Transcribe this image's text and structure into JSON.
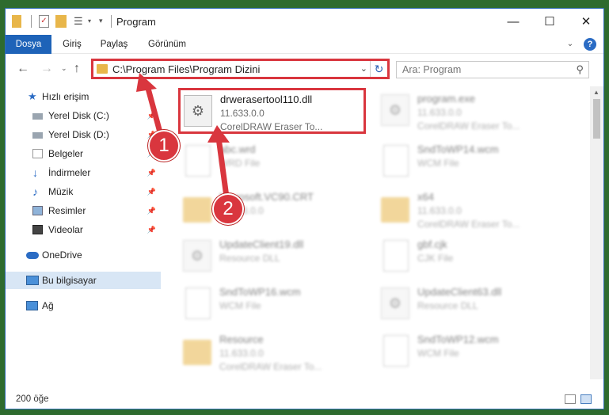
{
  "window": {
    "title": "Program"
  },
  "ribbon": {
    "tabs": [
      "Dosya",
      "Giriş",
      "Paylaş",
      "Görünüm"
    ]
  },
  "address": {
    "path": "C:\\Program Files\\Program Dizini"
  },
  "search": {
    "placeholder": "Ara: Program"
  },
  "sidebar": {
    "items": [
      {
        "label": "Hızlı erişim",
        "icon": "star-icon"
      },
      {
        "label": "Yerel Disk (C:)",
        "icon": "drive-icon"
      },
      {
        "label": "Yerel Disk (D:)",
        "icon": "drive-icon"
      },
      {
        "label": "Belgeler",
        "icon": "documents-icon"
      },
      {
        "label": "İndirmeler",
        "icon": "download-icon"
      },
      {
        "label": "Müzik",
        "icon": "music-icon"
      },
      {
        "label": "Resimler",
        "icon": "pictures-icon"
      },
      {
        "label": "Videolar",
        "icon": "video-icon"
      },
      {
        "label": "OneDrive",
        "icon": "cloud-icon"
      },
      {
        "label": "Bu bilgisayar",
        "icon": "computer-icon"
      },
      {
        "label": "Ağ",
        "icon": "network-icon"
      }
    ]
  },
  "files": [
    {
      "name": "drwerasertool110.dll",
      "line2": "11.633.0.0",
      "line3": "CorelDRAW Eraser To...",
      "icon": "gear-icon",
      "highlight": true
    },
    {
      "name": "program.exe",
      "line2": "11.633.0.0",
      "line3": "CorelDRAW Eraser To...",
      "icon": "gear-icon"
    },
    {
      "name": "abc.wrd",
      "line2": "WRD File",
      "line3": "",
      "icon": "document-icon"
    },
    {
      "name": "SndToWP14.wcm",
      "line2": "WCM File",
      "line3": "",
      "icon": "document-icon"
    },
    {
      "name": "Microsoft.VC90.CRT",
      "line2": "11.633.0.0",
      "line3": "",
      "icon": "folder-icon"
    },
    {
      "name": "x64",
      "line2": "11.633.0.0",
      "line3": "CorelDRAW Eraser To...",
      "icon": "folder-icon"
    },
    {
      "name": "UpdateClient19.dll",
      "line2": "Resource DLL",
      "line3": "",
      "icon": "gear-icon"
    },
    {
      "name": "gbf.cjk",
      "line2": "CJK File",
      "line3": "",
      "icon": "document-icon"
    },
    {
      "name": "SndToWP16.wcm",
      "line2": "WCM File",
      "line3": "",
      "icon": "document-icon"
    },
    {
      "name": "UpdateClient63.dll",
      "line2": "Resource DLL",
      "line3": "",
      "icon": "gear-icon"
    },
    {
      "name": "Resource",
      "line2": "11.633.0.0",
      "line3": "CorelDRAW Eraser To...",
      "icon": "folder-icon"
    },
    {
      "name": "SndToWP12.wcm",
      "line2": "WCM File",
      "line3": "",
      "icon": "document-icon"
    }
  ],
  "status": {
    "count": "200 öğe"
  },
  "annotations": {
    "step1": "1",
    "step2": "2"
  },
  "colors": {
    "accent": "#1e63b8",
    "highlight": "#d9363e",
    "folder": "#e8b64a"
  }
}
